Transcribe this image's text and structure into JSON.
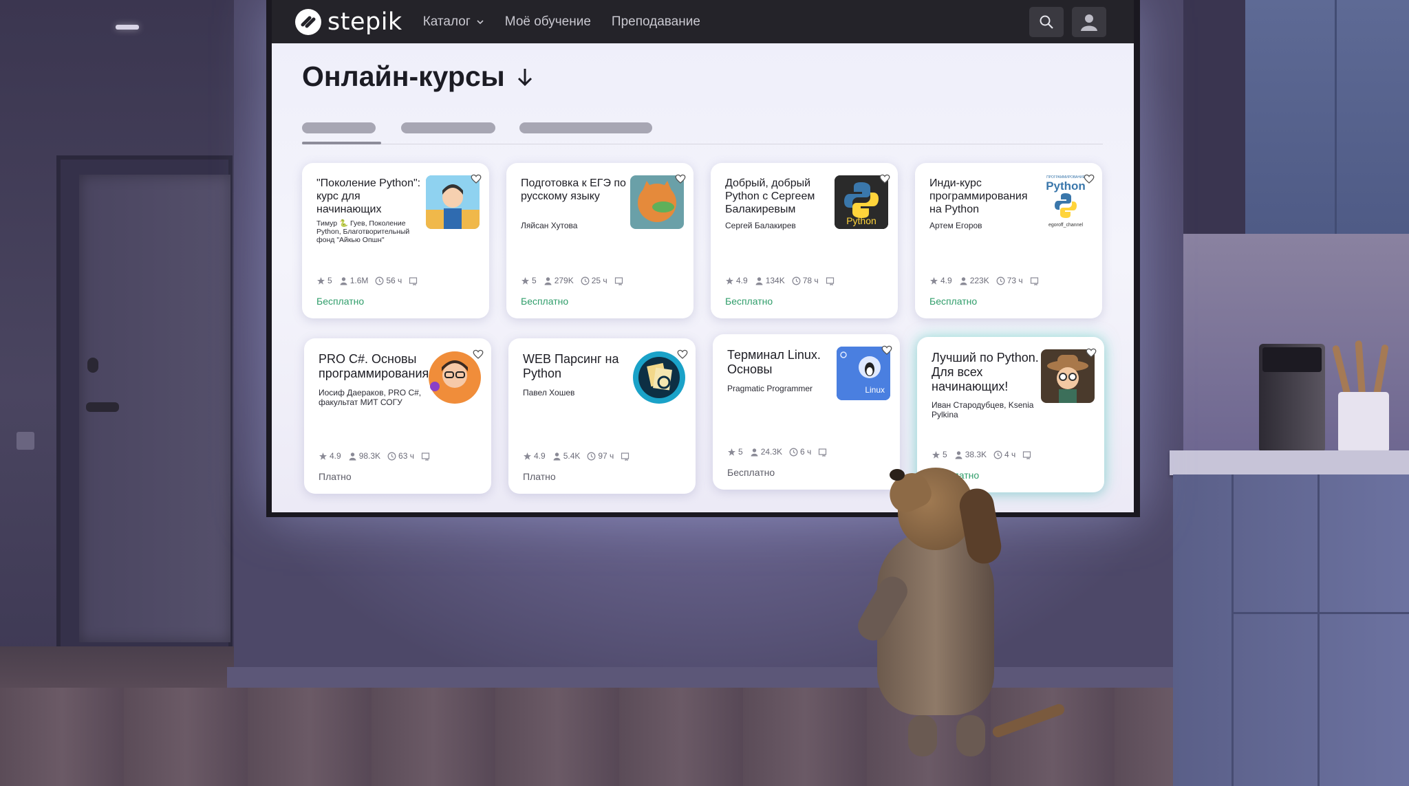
{
  "navbar": {
    "logo_text": "stepik",
    "catalog_label": "Каталог",
    "learning_label": "Моё обучение",
    "teaching_label": "Преподавание"
  },
  "page": {
    "title": "Онлайн-курсы"
  },
  "courses": [
    {
      "title": "\"Поколение Python\": курс для начинающих",
      "author": "Тимур 🐍 Гуев, Поколение Python, Благотворительный фонд \"Айкью Опшн\"",
      "rating": "5",
      "learners": "1.6M",
      "hours": "56 ч",
      "price": "Бесплатно",
      "thumb_icon": "cartoon-man-thumbnail",
      "thumb_color": "#6fc0e8"
    },
    {
      "title": "Подготовка к ЕГЭ по русскому языку",
      "author": "Ляйсан Хутова",
      "rating": "5",
      "learners": "279K",
      "hours": "25 ч",
      "price": "Бесплатно",
      "thumb_icon": "fox-thumbnail",
      "thumb_color": "#e58a3b"
    },
    {
      "title": "Добрый, добрый Python с Сергеем Балакиревым",
      "author": "Сергей Балакирев",
      "rating": "4.9",
      "learners": "134K",
      "hours": "78 ч",
      "price": "Бесплатно",
      "thumb_icon": "python-logo-dark-thumbnail",
      "thumb_color": "#2a2a2a",
      "thumb_text": "Python"
    },
    {
      "title": "Инди-курс программирования на Python",
      "author": "Артем Егоров",
      "rating": "4.9",
      "learners": "223K",
      "hours": "73 ч",
      "price": "Бесплатно",
      "thumb_icon": "python-logo-light-thumbnail",
      "thumb_color": "#ffffff",
      "thumb_text": "Python",
      "thumb_caption": "egoroff_channel",
      "thumb_overline": "ПРОГРАММИРОВАНИЕ"
    },
    {
      "title": "PRO C#. Основы программирования",
      "author": "Иосиф Даераков, PRO C#, факультат МИТ СОГУ",
      "rating": "4.9",
      "learners": "98.3K",
      "hours": "63 ч",
      "price": "Платно",
      "thumb_icon": "glasses-man-thumbnail",
      "thumb_color": "#e8843a"
    },
    {
      "title": "WEB Парсинг на Python",
      "author": "Павел Хошев",
      "rating": "4.9",
      "learners": "5.4K",
      "hours": "97 ч",
      "price": "Платно",
      "thumb_icon": "parsing-documents-thumbnail",
      "thumb_color": "#1aa2c8"
    },
    {
      "title": "Терминал Linux. Основы",
      "author": "Pragmatic Programmer",
      "rating": "5",
      "learners": "24.3K",
      "hours": "6 ч",
      "price": "Бесплатно",
      "thumb_icon": "linux-penguin-thumbnail",
      "thumb_color": "#4a7fe0",
      "thumb_text": "Linux"
    },
    {
      "title": "Лучший по Python. Для всех начинающих!",
      "author": "Иван Стародубцев, Ksenia Pylkina",
      "rating": "5",
      "learners": "38.3K",
      "hours": "4 ч",
      "price": "Бесплатно",
      "thumb_icon": "explorer-character-thumbnail",
      "thumb_color": "#7a5533"
    }
  ],
  "colors": {
    "navbar_bg": "#242329",
    "free_price": "#2f9d6a",
    "paid_price": "#5b5b66",
    "card_bg": "#ffffff"
  }
}
